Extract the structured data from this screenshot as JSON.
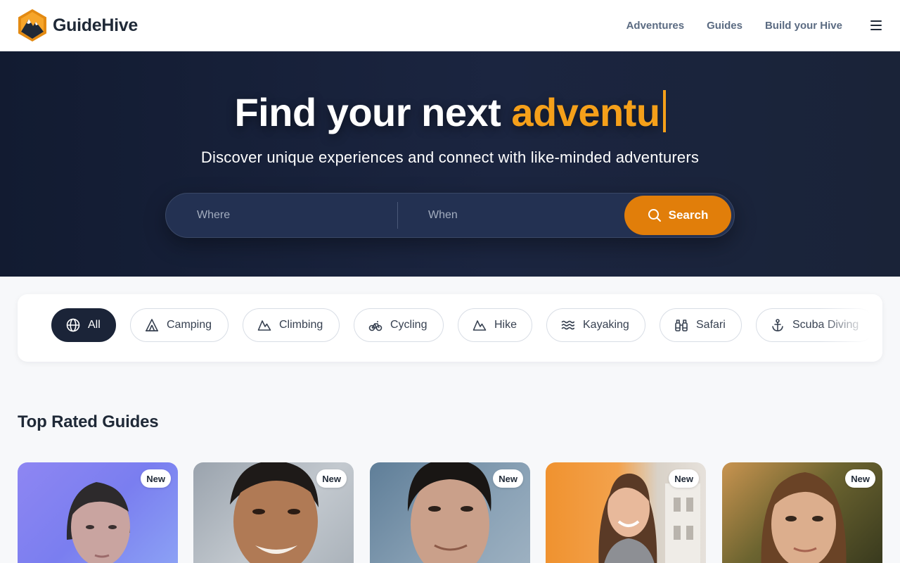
{
  "header": {
    "brand": "GuideHive",
    "nav": [
      "Adventures",
      "Guides",
      "Build your Hive"
    ]
  },
  "hero": {
    "title_main": "Find your next ",
    "title_accent": "adventu",
    "subtitle": "Discover unique experiences and connect with like-minded adventurers",
    "search": {
      "where_placeholder": "Where",
      "when_placeholder": "When",
      "button_label": "Search"
    }
  },
  "categories": [
    {
      "label": "All",
      "icon": "globe-icon",
      "active": true
    },
    {
      "label": "Camping",
      "icon": "tent-icon"
    },
    {
      "label": "Climbing",
      "icon": "mountain-icon"
    },
    {
      "label": "Cycling",
      "icon": "bike-icon"
    },
    {
      "label": "Hike",
      "icon": "mountain-icon"
    },
    {
      "label": "Kayaking",
      "icon": "waves-icon"
    },
    {
      "label": "Safari",
      "icon": "binoculars-icon"
    },
    {
      "label": "Scuba Diving",
      "icon": "anchor-icon"
    }
  ],
  "guides": {
    "title": "Top Rated Guides",
    "cards": [
      {
        "badge": "New"
      },
      {
        "badge": "New"
      },
      {
        "badge": "New"
      },
      {
        "badge": "New"
      },
      {
        "badge": "New"
      }
    ]
  },
  "colors": {
    "accent": "#f5a01a",
    "search_button": "#e17e0a",
    "hero_bg": "#1a2338",
    "chip_active": "#1b2438"
  }
}
